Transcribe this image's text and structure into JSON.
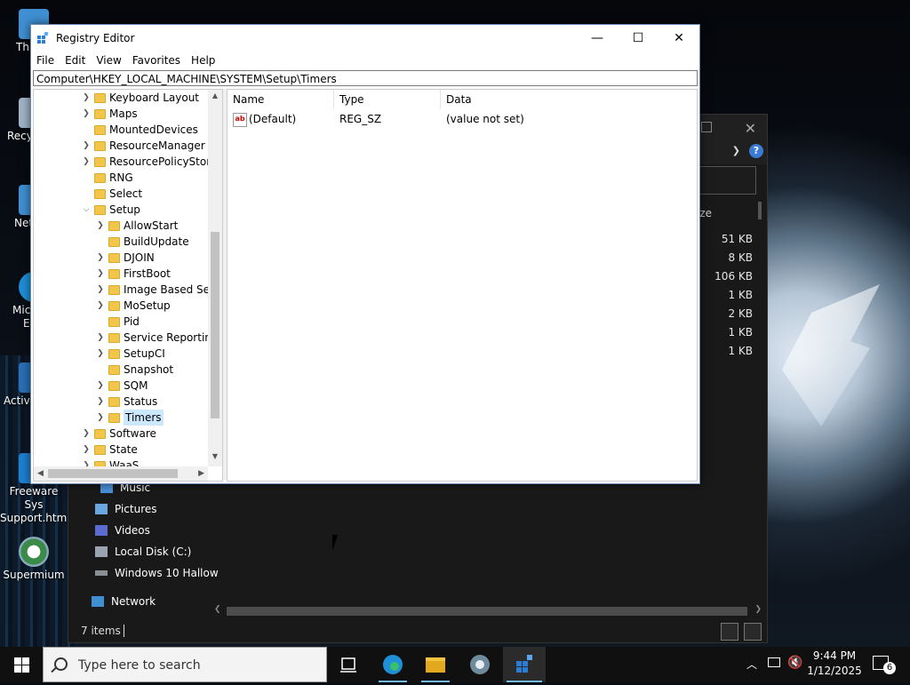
{
  "desktop": {
    "icons": [
      {
        "label": "Th",
        "name": "desktop-icon-this-pc"
      },
      {
        "label": "Recy",
        "name": "desktop-icon-recycle-bin"
      },
      {
        "label": "Net",
        "name": "desktop-icon-network"
      },
      {
        "label": "Mic",
        "label2": "E",
        "name": "desktop-icon-microsoft-edge"
      },
      {
        "label": "Activa",
        "name": "desktop-icon-activate"
      },
      {
        "label": "Freeware Sys",
        "label2": "Support.html",
        "name": "desktop-icon-freeware"
      },
      {
        "label": "Supermium",
        "name": "desktop-icon-supermium"
      }
    ]
  },
  "explorer": {
    "size_header": "ze",
    "sizes": [
      "51 KB",
      "8 KB",
      "106 KB",
      "1 KB",
      "2 KB",
      "1 KB",
      "1 KB"
    ],
    "nav": [
      "Music",
      "Pictures",
      "Videos",
      "Local Disk (C:)",
      "Windows 10 Hallow",
      "Network"
    ],
    "status": "7 items"
  },
  "regedit": {
    "title": "Registry Editor",
    "menu": [
      "File",
      "Edit",
      "View",
      "Favorites",
      "Help"
    ],
    "address": "Computer\\HKEY_LOCAL_MACHINE\\SYSTEM\\Setup\\Timers",
    "tree": [
      {
        "label": "Keyboard Layout",
        "level": 1,
        "expander": "collapsed"
      },
      {
        "label": "Maps",
        "level": 1,
        "expander": "collapsed"
      },
      {
        "label": "MountedDevices",
        "level": 1,
        "expander": "none"
      },
      {
        "label": "ResourceManager",
        "level": 1,
        "expander": "collapsed"
      },
      {
        "label": "ResourcePolicyStore",
        "level": 1,
        "expander": "collapsed"
      },
      {
        "label": "RNG",
        "level": 1,
        "expander": "none"
      },
      {
        "label": "Select",
        "level": 1,
        "expander": "none"
      },
      {
        "label": "Setup",
        "level": 1,
        "expander": "expanded"
      },
      {
        "label": "AllowStart",
        "level": 2,
        "expander": "collapsed"
      },
      {
        "label": "BuildUpdate",
        "level": 2,
        "expander": "none"
      },
      {
        "label": "DJOIN",
        "level": 2,
        "expander": "collapsed"
      },
      {
        "label": "FirstBoot",
        "level": 2,
        "expander": "collapsed"
      },
      {
        "label": "Image Based Setu",
        "level": 2,
        "expander": "collapsed"
      },
      {
        "label": "MoSetup",
        "level": 2,
        "expander": "collapsed"
      },
      {
        "label": "Pid",
        "level": 2,
        "expander": "none"
      },
      {
        "label": "Service Reporting",
        "level": 2,
        "expander": "collapsed"
      },
      {
        "label": "SetupCI",
        "level": 2,
        "expander": "collapsed"
      },
      {
        "label": "Snapshot",
        "level": 2,
        "expander": "none"
      },
      {
        "label": "SQM",
        "level": 2,
        "expander": "collapsed"
      },
      {
        "label": "Status",
        "level": 2,
        "expander": "collapsed"
      },
      {
        "label": "Timers",
        "level": 2,
        "expander": "collapsed",
        "selected": true
      },
      {
        "label": "Software",
        "level": 1,
        "expander": "collapsed"
      },
      {
        "label": "State",
        "level": 1,
        "expander": "collapsed"
      },
      {
        "label": "WaaS",
        "level": 1,
        "expander": "collapsed"
      }
    ],
    "columns": [
      "Name",
      "Type",
      "Data"
    ],
    "values": [
      {
        "name": "(Default)",
        "type": "REG_SZ",
        "data": "(value not set)"
      }
    ]
  },
  "taskbar": {
    "search_placeholder": "Type here to search",
    "time": "9:44 PM",
    "date": "1/12/2025",
    "notification_count": "6"
  }
}
